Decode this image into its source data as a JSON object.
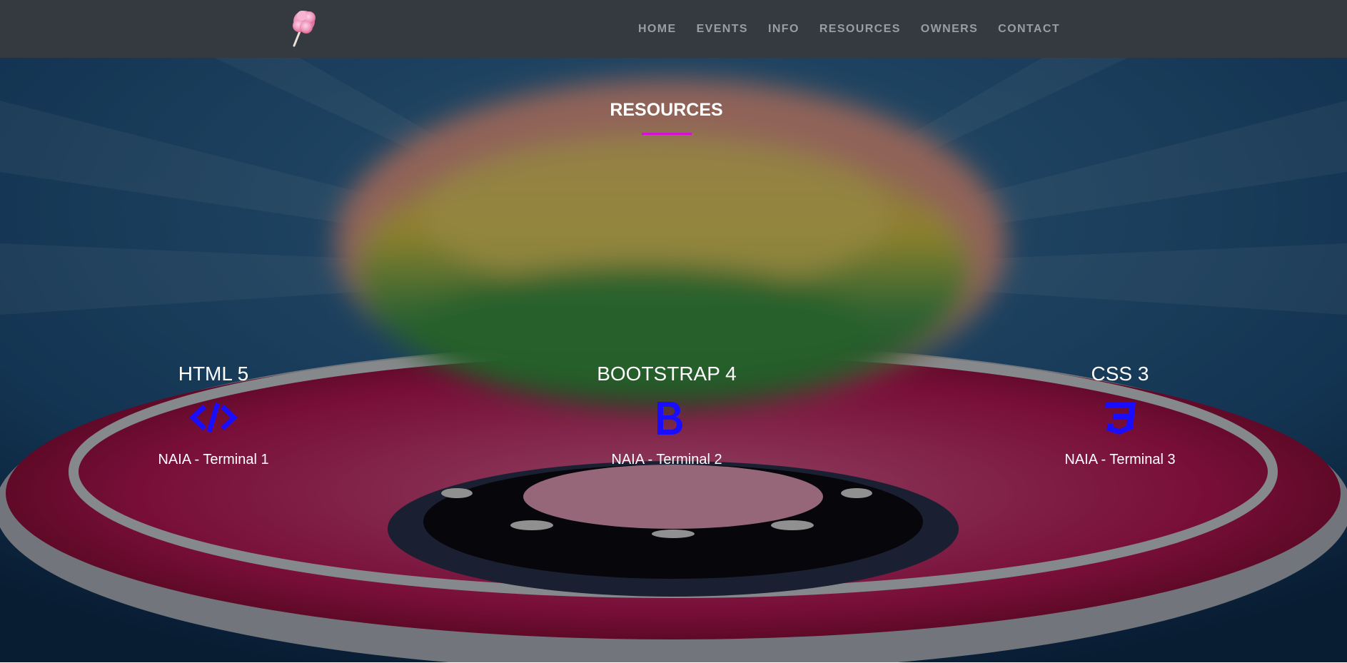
{
  "navbar": {
    "brand_icon": "cotton-candy-logo-icon",
    "links": [
      {
        "label": "HOME"
      },
      {
        "label": "EVENTS"
      },
      {
        "label": "INFO"
      },
      {
        "label": "RESOURCES"
      },
      {
        "label": "OWNERS"
      },
      {
        "label": "CONTACT"
      }
    ]
  },
  "section": {
    "title": "RESOURCES",
    "accent_color": "#d410d4",
    "cards": [
      {
        "title": "HTML 5",
        "icon": "code-icon",
        "text": "NAIA - Terminal 1"
      },
      {
        "title": "BOOTSTRAP 4",
        "icon": "bootstrap-icon",
        "text": "NAIA - Terminal 2"
      },
      {
        "title": "CSS 3",
        "icon": "css3-icon",
        "text": "NAIA - Terminal 3"
      }
    ],
    "icon_color": "#1a0dff"
  },
  "colors": {
    "navbar_bg": "#343a40",
    "nav_text": "#9a9da1"
  }
}
